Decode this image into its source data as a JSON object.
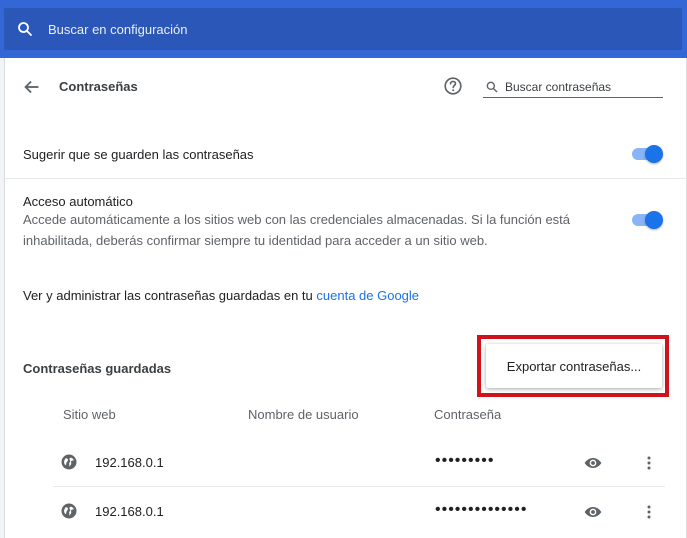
{
  "topbar": {
    "search_placeholder": "Buscar en configuración"
  },
  "header": {
    "title": "Contraseñas",
    "search_placeholder": "Buscar contraseñas"
  },
  "settings": {
    "suggest_label": "Sugerir que se guarden las contraseñas",
    "suggest_on": true,
    "autosignin_title": "Acceso automático",
    "autosignin_desc_line1": "Accede automáticamente a los sitios web con las credenciales almacenadas. Si la función está",
    "autosignin_desc_line2": "inhabilitada, deberás confirmar siempre tu identidad para acceder a un sitio web.",
    "autosignin_on": true,
    "manage_prefix": "Ver y administrar las contraseñas guardadas en tu ",
    "manage_link": "cuenta de Google"
  },
  "saved": {
    "section_title": "Contraseñas guardadas",
    "export_label": "Exportar contraseñas...",
    "columns": [
      "Sitio web",
      "Nombre de usuario",
      "Contraseña"
    ],
    "rows": [
      {
        "site": "192.168.0.1",
        "username": "",
        "password": "•••••••••"
      },
      {
        "site": "192.168.0.1",
        "username": "",
        "password": "••••••••••••••"
      }
    ]
  },
  "colors": {
    "topbar": "#3367d6",
    "accent": "#1a73e8",
    "highlight": "#d0121b"
  }
}
